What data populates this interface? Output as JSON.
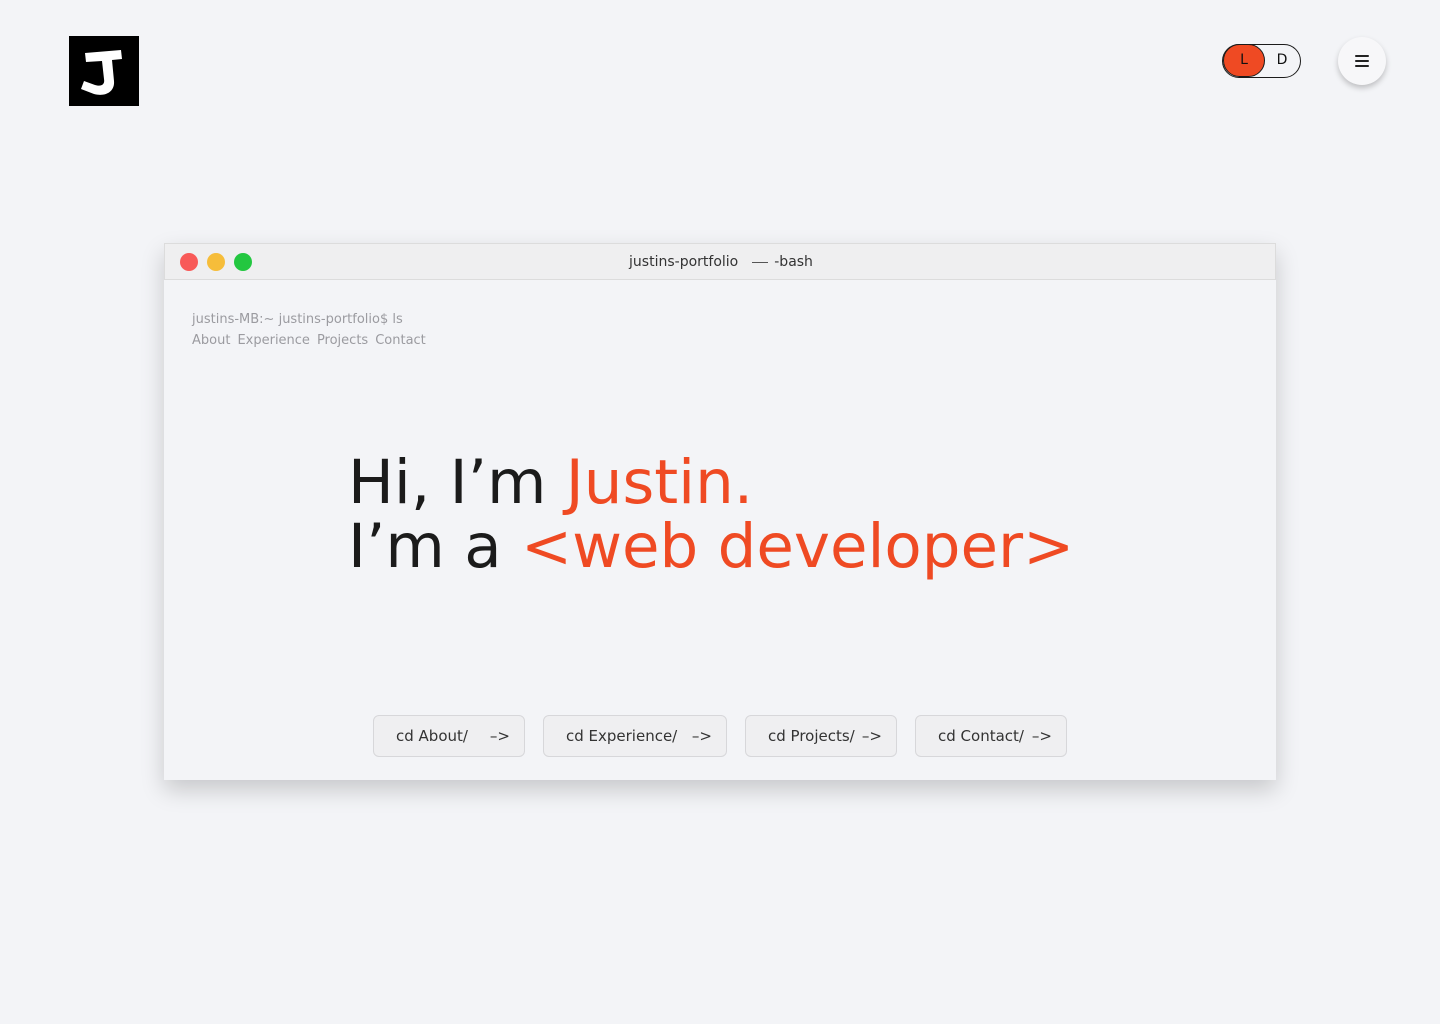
{
  "header": {
    "theme_toggle": {
      "light_label": "L",
      "dark_label": "D",
      "active": "light"
    }
  },
  "terminal": {
    "title": "justins-portfolio",
    "subtitle": "-bash",
    "prompt": "justins-MB:~ justins-portfolio$ ls",
    "ls_items": [
      "About",
      "Experience",
      "Projects",
      "Contact"
    ],
    "headline": {
      "line1_prefix": "Hi, I’m ",
      "line1_accent": "Justin.",
      "line2_prefix": "I’m a ",
      "line2_accent": "<web developer>"
    },
    "buttons": [
      {
        "label": "cd About/",
        "arrow": "–>"
      },
      {
        "label": "cd Experience/",
        "arrow": "–>"
      },
      {
        "label": "cd Projects/",
        "arrow": "–>"
      },
      {
        "label": "cd Contact/",
        "arrow": "–>"
      }
    ]
  },
  "colors": {
    "background": "#f3f4f7",
    "accent": "#ef4a23",
    "text": "#1b1b1b",
    "muted": "#9b9ba0",
    "traffic_red": "#f85a58",
    "traffic_yellow": "#f6bd3a",
    "traffic_green": "#23c740"
  },
  "icons": {
    "logo": "j-logo-icon",
    "menu": "hamburger-menu-icon"
  }
}
